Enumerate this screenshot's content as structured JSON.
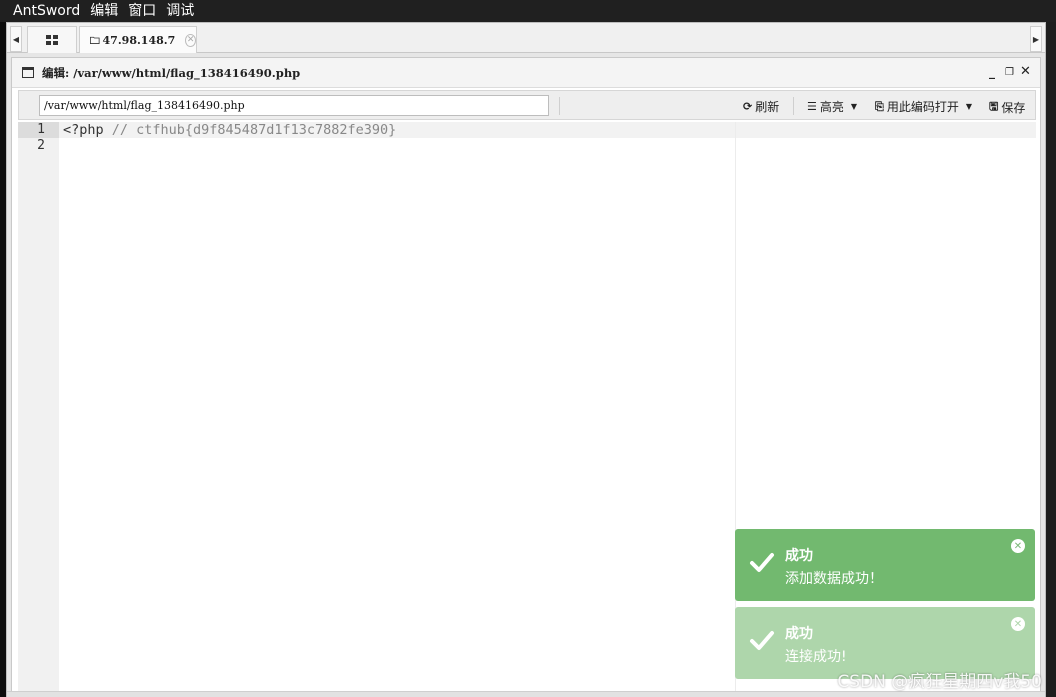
{
  "menubar": {
    "items": [
      "AntSword",
      "编辑",
      "窗口",
      "调试"
    ]
  },
  "tabs": {
    "host_label": "47.98.148.7",
    "home_icon": "grid-icon",
    "folder_icon": "folder-icon"
  },
  "editor": {
    "title": "编辑: /var/www/html/flag_138416490.php",
    "path_value": "/var/www/html/flag_138416490.php",
    "toolbar": {
      "refresh_label": "刷新",
      "highlight_label": "高亮",
      "open_with_encoding_label": "用此编码打开",
      "save_label": "保存"
    },
    "lines": [
      {
        "number": "1",
        "code_kw": "<?php",
        "code_comment": " // ctfhub{d9f845487d1f13c7882fe390}"
      },
      {
        "number": "2",
        "code_kw": "",
        "code_comment": ""
      }
    ]
  },
  "toasts": [
    {
      "title": "成功",
      "message": "添加数据成功！",
      "color": "#72b96f"
    },
    {
      "title": "成功",
      "message": "连接成功!",
      "color": "#aed6ab"
    }
  ],
  "watermark": "CSDN @疯狂星期四v我50"
}
